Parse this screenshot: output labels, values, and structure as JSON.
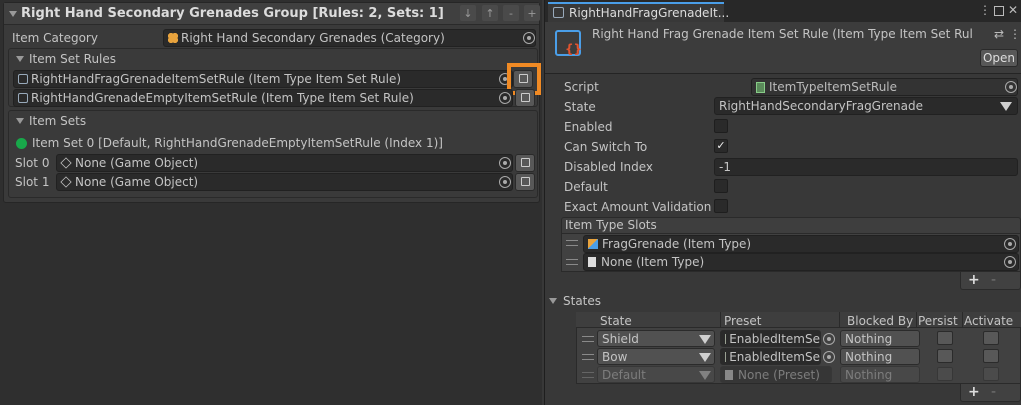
{
  "left": {
    "title": "Right Hand Secondary Grenades Group [Rules: 2, Sets: 1]",
    "toolbar_icons": [
      "arrow-down-icon",
      "arrow-up-icon",
      "minus-icon",
      "plus-icon"
    ],
    "item_category": {
      "label": "Item Category",
      "value": "Right Hand Secondary Grenades (Category)"
    },
    "item_set_rules": {
      "header": "Item Set Rules",
      "rows": [
        "RightHandFragGrenadeItemSetRule (Item Type Item Set Rule)",
        "RightHandGrenadeEmptyItemSetRule (Item Type Item Set Rule)"
      ]
    },
    "item_sets": {
      "header": "Item Sets",
      "set_title": "Item Set 0 [Default, RightHandGrenadeEmptyItemSetRule (Index 1)]",
      "slots": [
        {
          "label": "Slot 0",
          "value": "None (Game Object)"
        },
        {
          "label": "Slot 1",
          "value": "None (Game Object)"
        }
      ]
    }
  },
  "right": {
    "tab_label": "RightHandFragGrenadeIt...",
    "asset_title": "Right Hand Frag Grenade Item Set Rule (Item Type Item Set Rul",
    "open_label": "Open",
    "fields": {
      "script": {
        "label": "Script",
        "value": "ItemTypeItemSetRule"
      },
      "state": {
        "label": "State",
        "value": "RightHandSecondaryFragGrenade"
      },
      "enabled": {
        "label": "Enabled",
        "checked": false
      },
      "can_switch_to": {
        "label": "Can Switch To",
        "checked": true
      },
      "disabled_index": {
        "label": "Disabled Index",
        "value": "-1"
      },
      "default": {
        "label": "Default",
        "checked": false
      },
      "exact_amount": {
        "label": "Exact Amount Validation",
        "checked": false
      }
    },
    "item_type_slots": {
      "header": "Item Type Slots",
      "rows": [
        "FragGrenade (Item Type)",
        "None (Item Type)"
      ],
      "add": "+",
      "remove": "-"
    },
    "states": {
      "header": "States",
      "columns": [
        "State",
        "Preset",
        "Blocked By",
        "Persist",
        "Activate"
      ],
      "rows": [
        {
          "state": "Shield",
          "preset": "EnabledItemSe",
          "blocked": "Nothing",
          "disabled": false
        },
        {
          "state": "Bow",
          "preset": "EnabledItemSe",
          "blocked": "Nothing",
          "disabled": false
        },
        {
          "state": "Default",
          "preset": "None (Preset)",
          "blocked": "Nothing",
          "disabled": true
        }
      ],
      "add": "+",
      "remove": "-"
    }
  },
  "colors": {
    "highlight": "#f08a24",
    "panel": "#383838",
    "field": "#2a2a2a",
    "green_dot": "#18a84a",
    "accent_cube": "#4a9ee8"
  }
}
